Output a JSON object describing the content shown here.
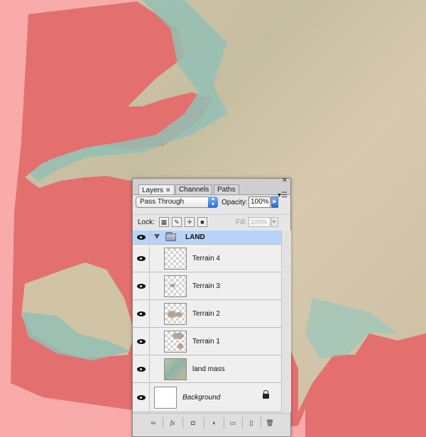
{
  "canvas": {
    "colors": {
      "water_overlay": "#e86a6a",
      "land_green": "#8fc2b6",
      "land_tan": "#d9c8ac"
    }
  },
  "layers_panel": {
    "tabs": [
      {
        "label": "Layers",
        "active": true
      },
      {
        "label": "Channels",
        "active": false
      },
      {
        "label": "Paths",
        "active": false
      }
    ],
    "blend_mode": "Pass Through",
    "opacity_label": "Opacity:",
    "opacity_value": "100%",
    "lock_label": "Lock:",
    "fill_label": "Fill:",
    "fill_value": "100%",
    "group": {
      "name": "LAND",
      "expanded": true
    },
    "layers": [
      {
        "name": "Terrain 4",
        "visible": true
      },
      {
        "name": "Terrain 3",
        "visible": true
      },
      {
        "name": "Terrain 2",
        "visible": true
      },
      {
        "name": "Terrain 1",
        "visible": true
      },
      {
        "name": "land mass",
        "visible": true
      }
    ],
    "background": {
      "name": "Background",
      "locked": true,
      "visible": true
    },
    "toolbar": {
      "link_icon": "∞",
      "fx_icon": "fx",
      "mask_icon": "◘",
      "adjustment_icon": "◐",
      "new_group_icon": "▭",
      "new_layer_icon": "▯",
      "delete_icon": "🗑"
    },
    "colors": {
      "selected_row": "#b9d3f8",
      "accent_blue": "#2b6ad8"
    }
  }
}
